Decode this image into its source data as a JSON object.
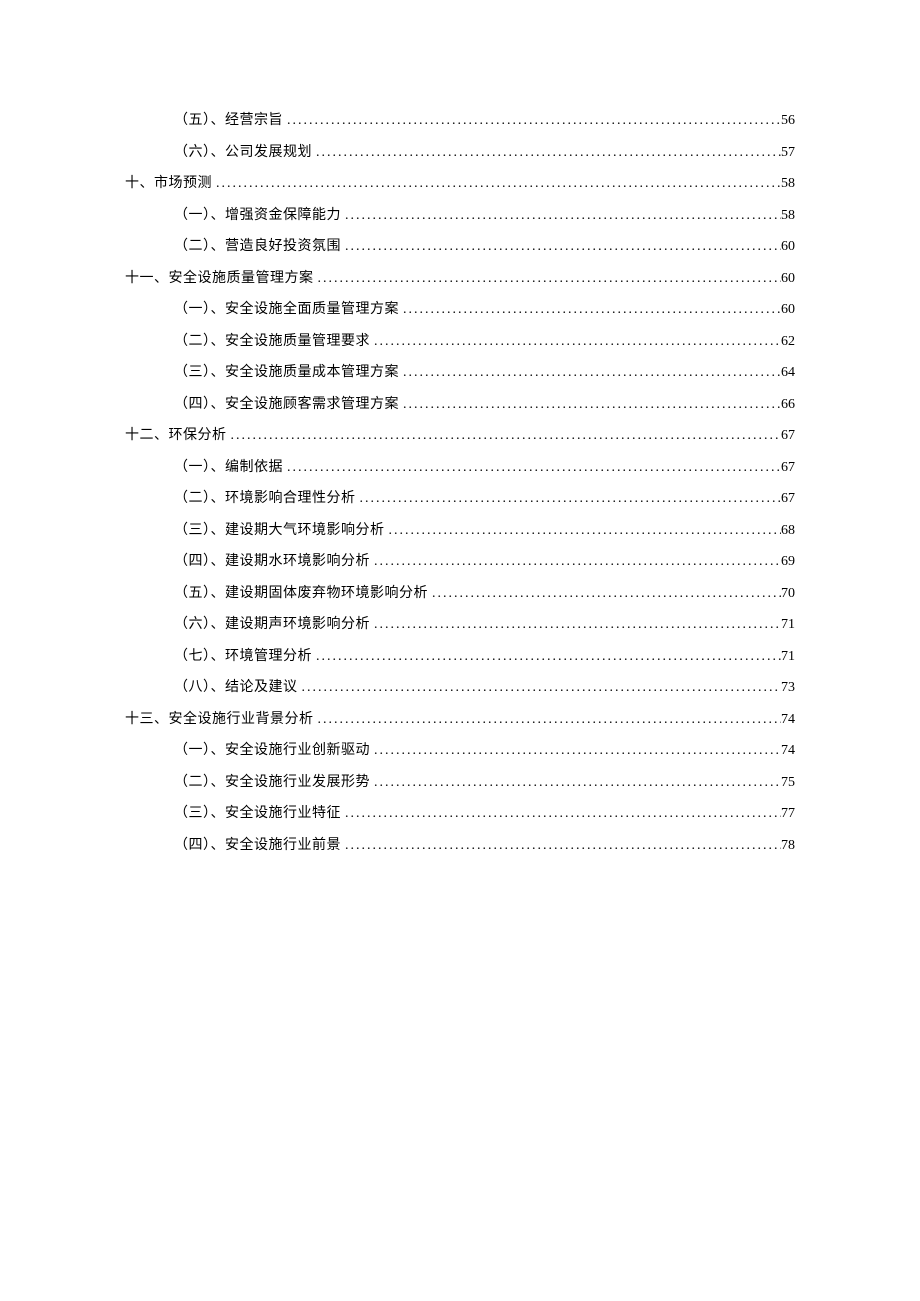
{
  "toc": [
    {
      "level": 2,
      "label": "（五）、经营宗旨",
      "page": "56"
    },
    {
      "level": 2,
      "label": "（六）、公司发展规划",
      "page": "57"
    },
    {
      "level": 1,
      "label": "十、市场预测",
      "page": "58"
    },
    {
      "level": 2,
      "label": "（一）、增强资金保障能力",
      "page": "58"
    },
    {
      "level": 2,
      "label": "（二）、营造良好投资氛围",
      "page": "60"
    },
    {
      "level": 1,
      "label": "十一、安全设施质量管理方案",
      "page": "60"
    },
    {
      "level": 2,
      "label": "（一）、安全设施全面质量管理方案",
      "page": "60"
    },
    {
      "level": 2,
      "label": "（二）、安全设施质量管理要求",
      "page": "62"
    },
    {
      "level": 2,
      "label": "（三）、安全设施质量成本管理方案",
      "page": "64"
    },
    {
      "level": 2,
      "label": "（四）、安全设施顾客需求管理方案",
      "page": "66"
    },
    {
      "level": 1,
      "label": "十二、环保分析",
      "page": "67"
    },
    {
      "level": 2,
      "label": "（一）、编制依据",
      "page": "67"
    },
    {
      "level": 2,
      "label": "（二）、环境影响合理性分析",
      "page": "67"
    },
    {
      "level": 2,
      "label": "（三）、建设期大气环境影响分析",
      "page": "68"
    },
    {
      "level": 2,
      "label": "（四）、建设期水环境影响分析",
      "page": "69"
    },
    {
      "level": 2,
      "label": "（五）、建设期固体废弃物环境影响分析",
      "page": "70"
    },
    {
      "level": 2,
      "label": "（六）、建设期声环境影响分析",
      "page": "71"
    },
    {
      "level": 2,
      "label": "（七）、环境管理分析",
      "page": "71"
    },
    {
      "level": 2,
      "label": "（八）、结论及建议",
      "page": "73"
    },
    {
      "level": 1,
      "label": "十三、安全设施行业背景分析",
      "page": "74"
    },
    {
      "level": 2,
      "label": "（一）、安全设施行业创新驱动",
      "page": "74"
    },
    {
      "level": 2,
      "label": "（二）、安全设施行业发展形势",
      "page": "75"
    },
    {
      "level": 2,
      "label": "（三）、安全设施行业特征",
      "page": "77"
    },
    {
      "level": 2,
      "label": "（四）、安全设施行业前景",
      "page": "78"
    }
  ]
}
